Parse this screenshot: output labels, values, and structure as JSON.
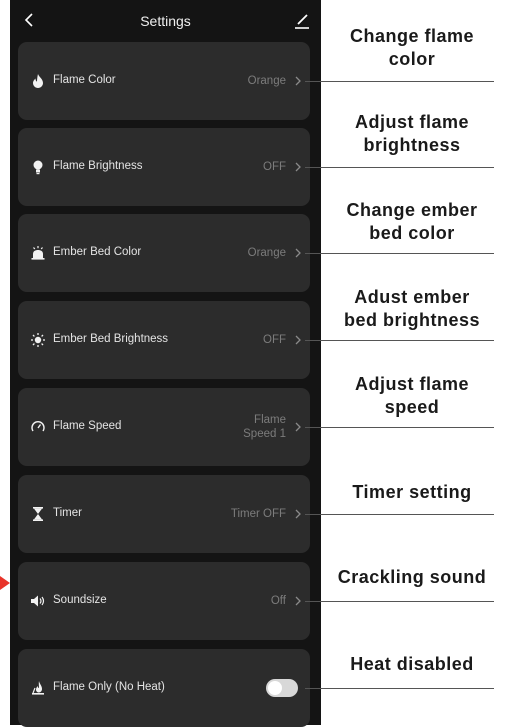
{
  "header": {
    "title": "Settings"
  },
  "rows": [
    {
      "label": "Flame Color",
      "value": "Orange",
      "icon": "flame-icon"
    },
    {
      "label": "Flame Brightness",
      "value": "OFF",
      "icon": "bulb-icon"
    },
    {
      "label": "Ember Bed Color",
      "value": "Orange",
      "icon": "ember-bed-icon"
    },
    {
      "label": "Ember Bed Brightness",
      "value": "OFF",
      "icon": "sun-icon"
    },
    {
      "label": "Flame Speed",
      "value_line1": "Flame",
      "value_line2": "Speed 1",
      "icon": "speed-gauge-icon"
    },
    {
      "label": "Timer",
      "value": "Timer OFF",
      "icon": "hourglass-icon"
    },
    {
      "label": "Soundsize",
      "value": "Off",
      "icon": "speaker-icon"
    },
    {
      "label": "Flame Only (No Heat)",
      "toggle": "off",
      "icon": "flame-only-icon"
    }
  ],
  "annotations": [
    {
      "line1": "Change flame",
      "line2": "color"
    },
    {
      "line1": "Adjust flame",
      "line2": "brightness"
    },
    {
      "line1": "Change ember",
      "line2": "bed color"
    },
    {
      "line1": "Adust ember",
      "line2": "bed brightness"
    },
    {
      "line1": "Adjust flame",
      "line2": "speed"
    },
    {
      "line1": "Timer setting"
    },
    {
      "line1": "Crackling sound"
    },
    {
      "line1": "Heat disabled"
    }
  ],
  "colors": {
    "screen_bg": "#141414",
    "card_bg": "#2c2c2c",
    "label_text": "#e4e4e4",
    "value_text": "#7c7c7c",
    "caption_text": "#1a1a1a",
    "pointer_arrow": "#e8342a"
  }
}
